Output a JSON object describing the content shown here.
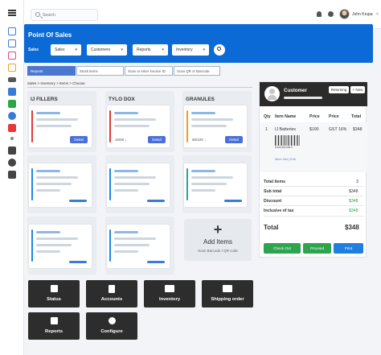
{
  "topbar": {
    "search_placeholder": "Search",
    "user_name": "John Krupa",
    "chevron": "˅"
  },
  "header": {
    "title": "Point Of Sales",
    "sales_label": "Sales",
    "dropdowns": [
      {
        "label": "Sales",
        "arrow": "▾"
      },
      {
        "label": "Customers",
        "arrow": "▾"
      },
      {
        "label": "Reports",
        "arrow": "▾"
      },
      {
        "label": "Inventory",
        "arrow": "▾"
      }
    ]
  },
  "tabs": [
    {
      "label": "Reports"
    },
    {
      "label": "Stock items"
    },
    {
      "label": "Scan or enter invoice ID"
    },
    {
      "label": "Scan QR or Barcode"
    }
  ],
  "breadcrumb": "Sales > Inventory > Items > Choose",
  "sections": [
    {
      "title": "IJ FILLERS",
      "stock": "",
      "detail": "Detail",
      "accent": "#e53935"
    },
    {
      "title": "TYLO DOX",
      "stock": "15/50",
      "arrow": "↓",
      "detail": "Detail",
      "accent": "#e53935"
    },
    {
      "title": "GRANULES",
      "stock": "50/100",
      "arrow": "↓",
      "detail": "Detail",
      "accent": "#f0a020"
    }
  ],
  "add_items": {
    "plus": "+",
    "title": "Add Items",
    "subtitle": "Scan Barcode / QR code"
  },
  "tiles": [
    {
      "label": "Status"
    },
    {
      "label": "Accounts"
    },
    {
      "label": "Inventory"
    },
    {
      "label": "Shipping order"
    },
    {
      "label": "Reports"
    },
    {
      "label": "Configure"
    }
  ],
  "customer": {
    "label": "Customer",
    "returning": "Returning",
    "new": "+ New"
  },
  "order_table": {
    "headers": [
      "Qty",
      "Item Name",
      "Price",
      "Price",
      "Total"
    ],
    "row": {
      "qty": "1",
      "name": "IJ Batteries",
      "price1": "$100",
      "price2": "GST 16%",
      "total": "$348",
      "barcode_number": "8 906 000 000 5",
      "more": "More Info | Edit"
    }
  },
  "totals": {
    "items_label": "Total items",
    "items_value": "3",
    "subtotal_label": "Sub total",
    "subtotal_value": "$348",
    "discount_label": "Discount",
    "discount_value": "$348",
    "tax_label": "Inclusive of tax",
    "tax_value": "$348",
    "total_label": "Total",
    "total_value": "$348"
  },
  "actions": {
    "checkout": "Check Out",
    "proceed": "Proceed",
    "print": "Print"
  },
  "colors": {
    "primary": "#0b6ad6",
    "dark": "#2d2d2d",
    "green": "#28a745",
    "red_accent": "#e53935",
    "orange_accent": "#f0a020"
  }
}
